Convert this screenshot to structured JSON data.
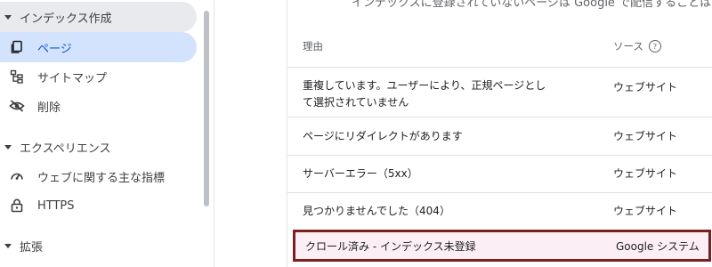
{
  "sidebar": {
    "sections": [
      {
        "label": "インデックス作成"
      },
      {
        "label": "エクスペリエンス"
      },
      {
        "label": "拡張"
      }
    ],
    "items": [
      {
        "label": "ページ",
        "icon": "pages-icon"
      },
      {
        "label": "サイトマップ",
        "icon": "sitemap-icon"
      },
      {
        "label": "削除",
        "icon": "removals-icon"
      },
      {
        "label": "ウェブに関する主な指標",
        "icon": "gauge-icon"
      },
      {
        "label": "HTTPS",
        "icon": "lock-icon"
      }
    ]
  },
  "main": {
    "top_hint": "インデックスに登録されていないページは Google で配信することはできません",
    "headers": {
      "reason": "理由",
      "source": "ソース"
    },
    "rows": [
      {
        "reason_line1": "重複しています。ユーザーにより、正規ページとし",
        "reason_line2": "て選択されていません",
        "source": "ウェブサイト"
      },
      {
        "reason": "ページにリダイレクトがあります",
        "source": "ウェブサイト"
      },
      {
        "reason": "サーバーエラー（5xx）",
        "source": "ウェブサイト"
      },
      {
        "reason": "見つかりませんでした（404）",
        "source": "ウェブサイト"
      },
      {
        "reason": "クロール済み - インデックス未登録",
        "source": "Google システム"
      }
    ]
  },
  "colors": {
    "selected_bg": "#d3e3fd",
    "highlight_border": "#7b1f1f",
    "highlight_bg": "#fbeff5"
  }
}
